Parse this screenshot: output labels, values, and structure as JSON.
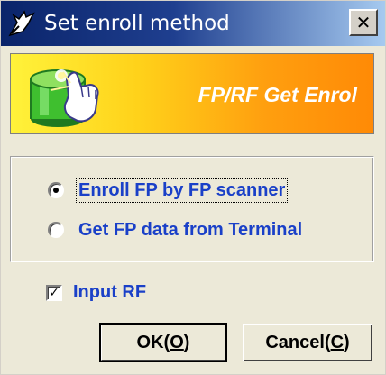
{
  "window": {
    "title": "Set enroll method",
    "close_glyph": "✕"
  },
  "banner": {
    "text": "FP/RF Get Enrol",
    "gradient_colors": [
      "#fff23a",
      "#ff8a06"
    ],
    "icon": "database-finger-icon"
  },
  "options": [
    {
      "label": "Enroll FP by FP scanner",
      "selected": true
    },
    {
      "label": "Get FP data from Terminal",
      "selected": false
    }
  ],
  "checkbox": {
    "label": "Input RF",
    "checked": true,
    "check_glyph": "✓"
  },
  "buttons": {
    "ok": {
      "text": "OK(",
      "key": "O",
      "suffix": ")"
    },
    "cancel": {
      "text": "Cancel(",
      "key": "C",
      "suffix": ")"
    }
  },
  "colors": {
    "label_blue": "#1a40c8",
    "titlebar": "#0a246a",
    "face": "#ece9d8"
  }
}
